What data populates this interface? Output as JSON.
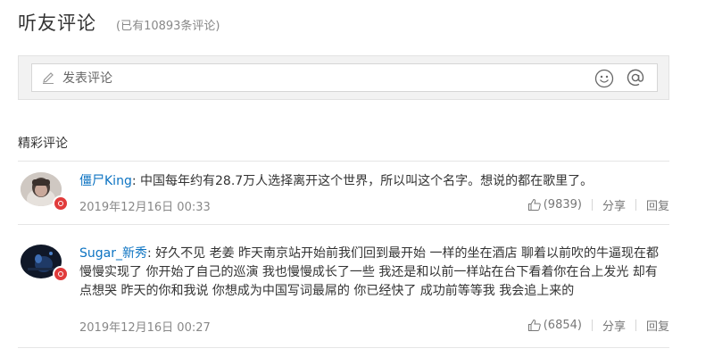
{
  "header": {
    "title": "听友评论",
    "count_text": "(已有10893条评论)"
  },
  "editor": {
    "placeholder": "发表评论",
    "emoji_icon": "smiley-icon",
    "at_icon": "at-icon"
  },
  "section": {
    "title": "精彩评论"
  },
  "comments": [
    {
      "user": "僵尸King",
      "colon": ": ",
      "text": "中国每年约有28.7万人选择离开这个世界，所以叫这个名字。想说的都在歌里了。",
      "time": "2019年12月16日 00:33",
      "likes": "(9839)",
      "share": "分享",
      "reply": "回复"
    },
    {
      "user": "Sugar_新秀",
      "colon": ": ",
      "text": "好久不见 老姜 昨天南京站开始前我们回到最开始 一样的坐在酒店 聊着以前吹的牛逼现在都慢慢实现了 你开始了自己的巡演 我也慢慢成长了一些 我还是和以前一样站在台下看着你在台上发光 却有点想哭 昨天的你和我说 你想成为中国写词最屌的 你已经快了 成功前等等我 我会追上来的",
      "time": "2019年12月16日 00:27",
      "likes": "(6854)",
      "share": "分享",
      "reply": "回复"
    }
  ],
  "colors": {
    "link": "#0c73c2",
    "badge": "#e13b3b"
  }
}
